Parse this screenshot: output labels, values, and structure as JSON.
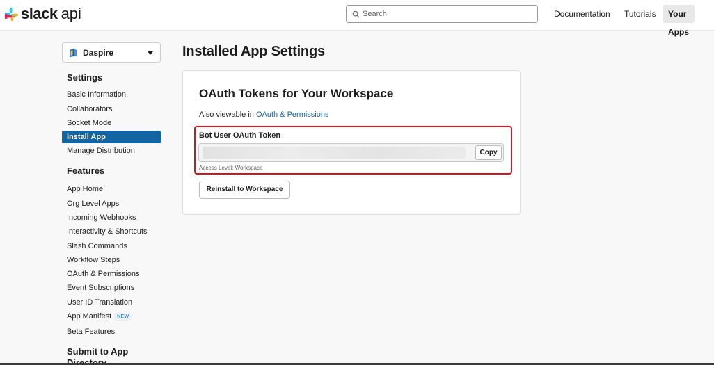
{
  "header": {
    "logo_word": "slack",
    "logo_suffix": "api",
    "search_placeholder": "Search",
    "nav": {
      "documentation": "Documentation",
      "tutorials": "Tutorials",
      "your_apps": "Your Apps"
    }
  },
  "sidebar": {
    "app_name": "Daspire",
    "settings_heading": "Settings",
    "settings_items": [
      "Basic Information",
      "Collaborators",
      "Socket Mode",
      "Install App",
      "Manage Distribution"
    ],
    "active_item": "Install App",
    "features_heading": "Features",
    "features_items": [
      "App Home",
      "Org Level Apps",
      "Incoming Webhooks",
      "Interactivity & Shortcuts",
      "Slash Commands",
      "Workflow Steps",
      "OAuth & Permissions",
      "Event Subscriptions",
      "User ID Translation",
      "App Manifest",
      "Beta Features"
    ],
    "new_badge": "NEW",
    "submit_heading_line1": "Submit to App",
    "submit_heading_line2": "Directory"
  },
  "main": {
    "page_title": "Installed App Settings",
    "card_title": "OAuth Tokens for Your Workspace",
    "also_prefix": "Also viewable in ",
    "also_link": "OAuth & Permissions",
    "token_label": "Bot User OAuth Token",
    "copy_label": "Copy",
    "access_level": "Access Level: Workspace",
    "reinstall_label": "Reinstall to Workspace"
  },
  "colors": {
    "accent": "#1264a3",
    "highlight": "#d3151c"
  }
}
